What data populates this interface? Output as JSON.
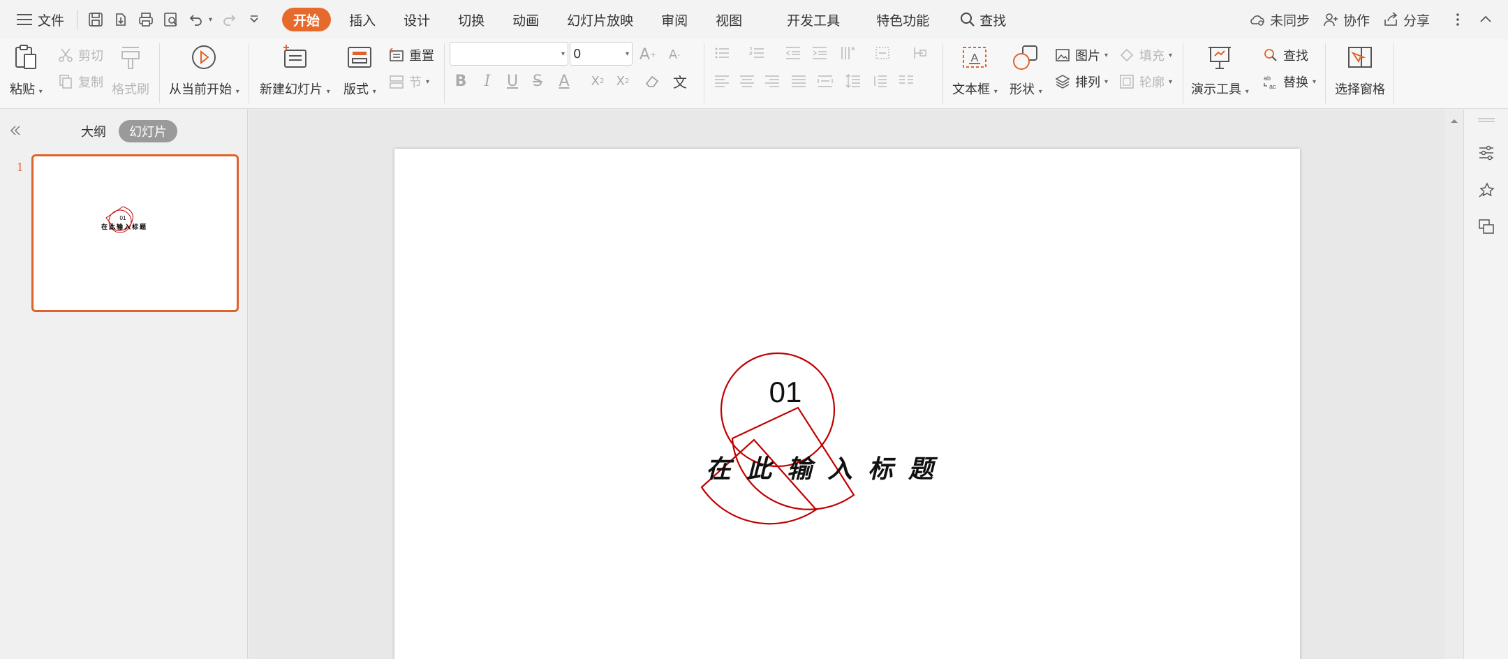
{
  "menubar": {
    "file_label": "文件",
    "tabs": [
      "开始",
      "插入",
      "设计",
      "切换",
      "动画",
      "幻灯片放映",
      "审阅",
      "视图",
      "开发工具",
      "特色功能"
    ],
    "active_tab": "开始",
    "search_label": "查找",
    "sync_label": "未同步",
    "collab_label": "协作",
    "share_label": "分享"
  },
  "ribbon": {
    "paste": "粘贴",
    "cut": "剪切",
    "copy": "复制",
    "format_painter": "格式刷",
    "from_current": "从当前开始",
    "new_slide": "新建幻灯片",
    "layout": "版式",
    "reset": "重置",
    "section": "节",
    "font_size_value": "0",
    "text_box": "文本框",
    "shape": "形状",
    "picture": "图片",
    "fill": "填充",
    "arrange": "排列",
    "outline": "轮廓",
    "presentation_tools": "演示工具",
    "find": "查找",
    "replace": "替换",
    "selection_pane": "选择窗格"
  },
  "leftpanel": {
    "outline_tab": "大纲",
    "slides_tab": "幻灯片",
    "slide_number": "1"
  },
  "slide": {
    "number": "01",
    "title": "在此输入标题"
  },
  "colors": {
    "accent": "#e66a2c",
    "shape_red": "#c00000"
  }
}
